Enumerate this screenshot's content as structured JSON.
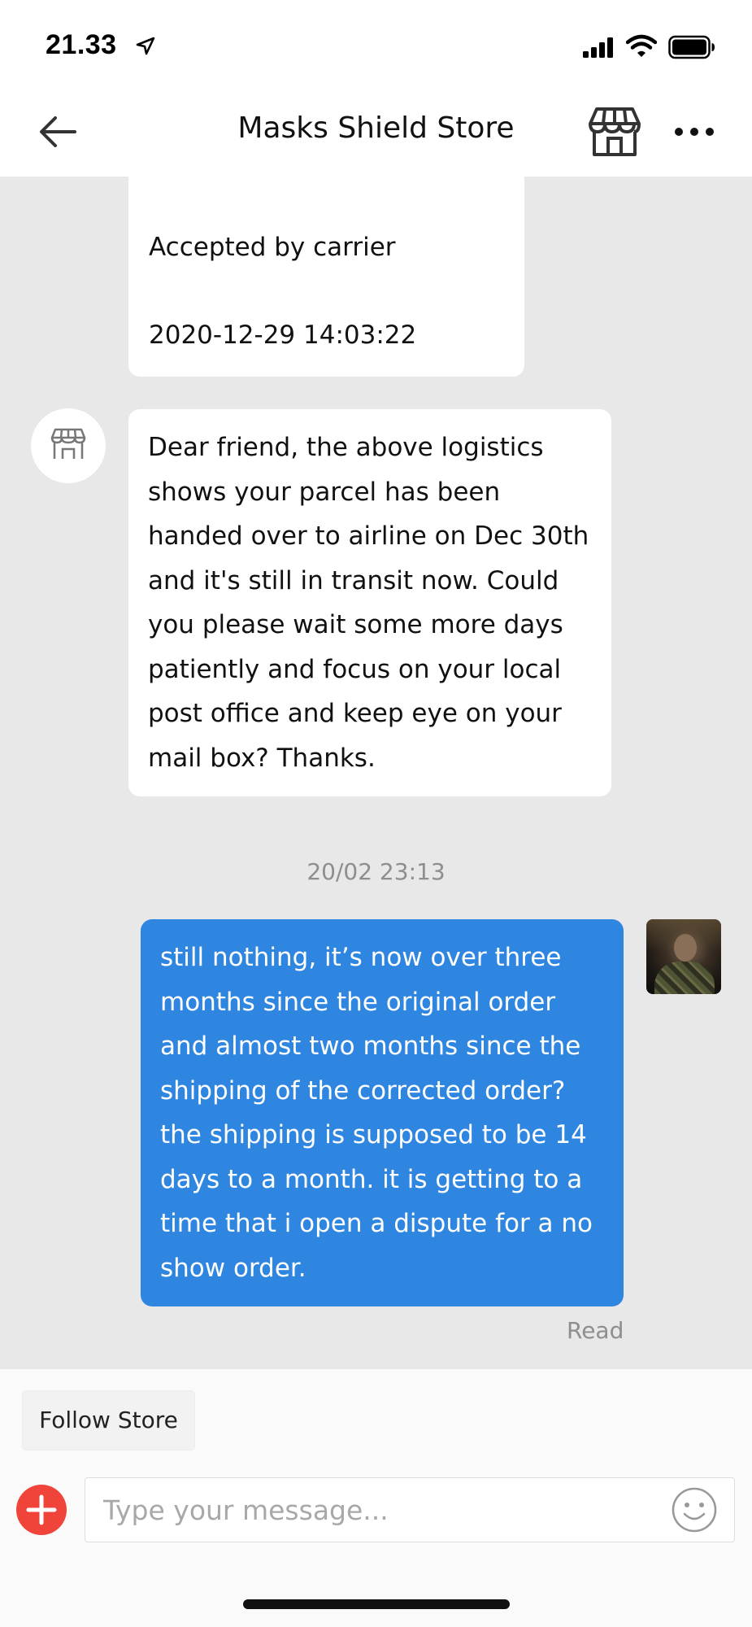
{
  "status_bar": {
    "time": "21.33",
    "icons": [
      "location-arrow-icon",
      "cellular-signal-icon",
      "wifi-icon",
      "battery-icon"
    ]
  },
  "header": {
    "title": "Masks Shield Store",
    "icons": [
      "back-arrow-icon",
      "store-icon",
      "more-icon"
    ]
  },
  "messages": {
    "incoming": [
      {
        "lines": [
          "Accepted by carrier",
          "2020-12-29 14:03:22"
        ]
      },
      {
        "text": "Dear friend, the above logistics shows your parcel has been handed over to airline on Dec 30th and it's still in transit now. Could you please wait some more days patiently and focus on your local post office and keep eye on your mail box? Thanks."
      }
    ],
    "timestamp": "20/02 23:13",
    "outgoing": {
      "text": "still nothing, it’s now over three months since the original order and almost two months since the shipping of the corrected order? the shipping is supposed to be 14 days to a month. it is getting to a time that i open a dispute for a no show order.",
      "status": "Read"
    }
  },
  "footer": {
    "follow_label": "Follow Store",
    "input_placeholder": "Type your message...",
    "icons": [
      "add-icon",
      "emoji-icon"
    ]
  },
  "colors": {
    "outgoing_bubble": "#2f86e0",
    "add_button": "#f0443a",
    "chat_background": "#e8e8e8"
  }
}
